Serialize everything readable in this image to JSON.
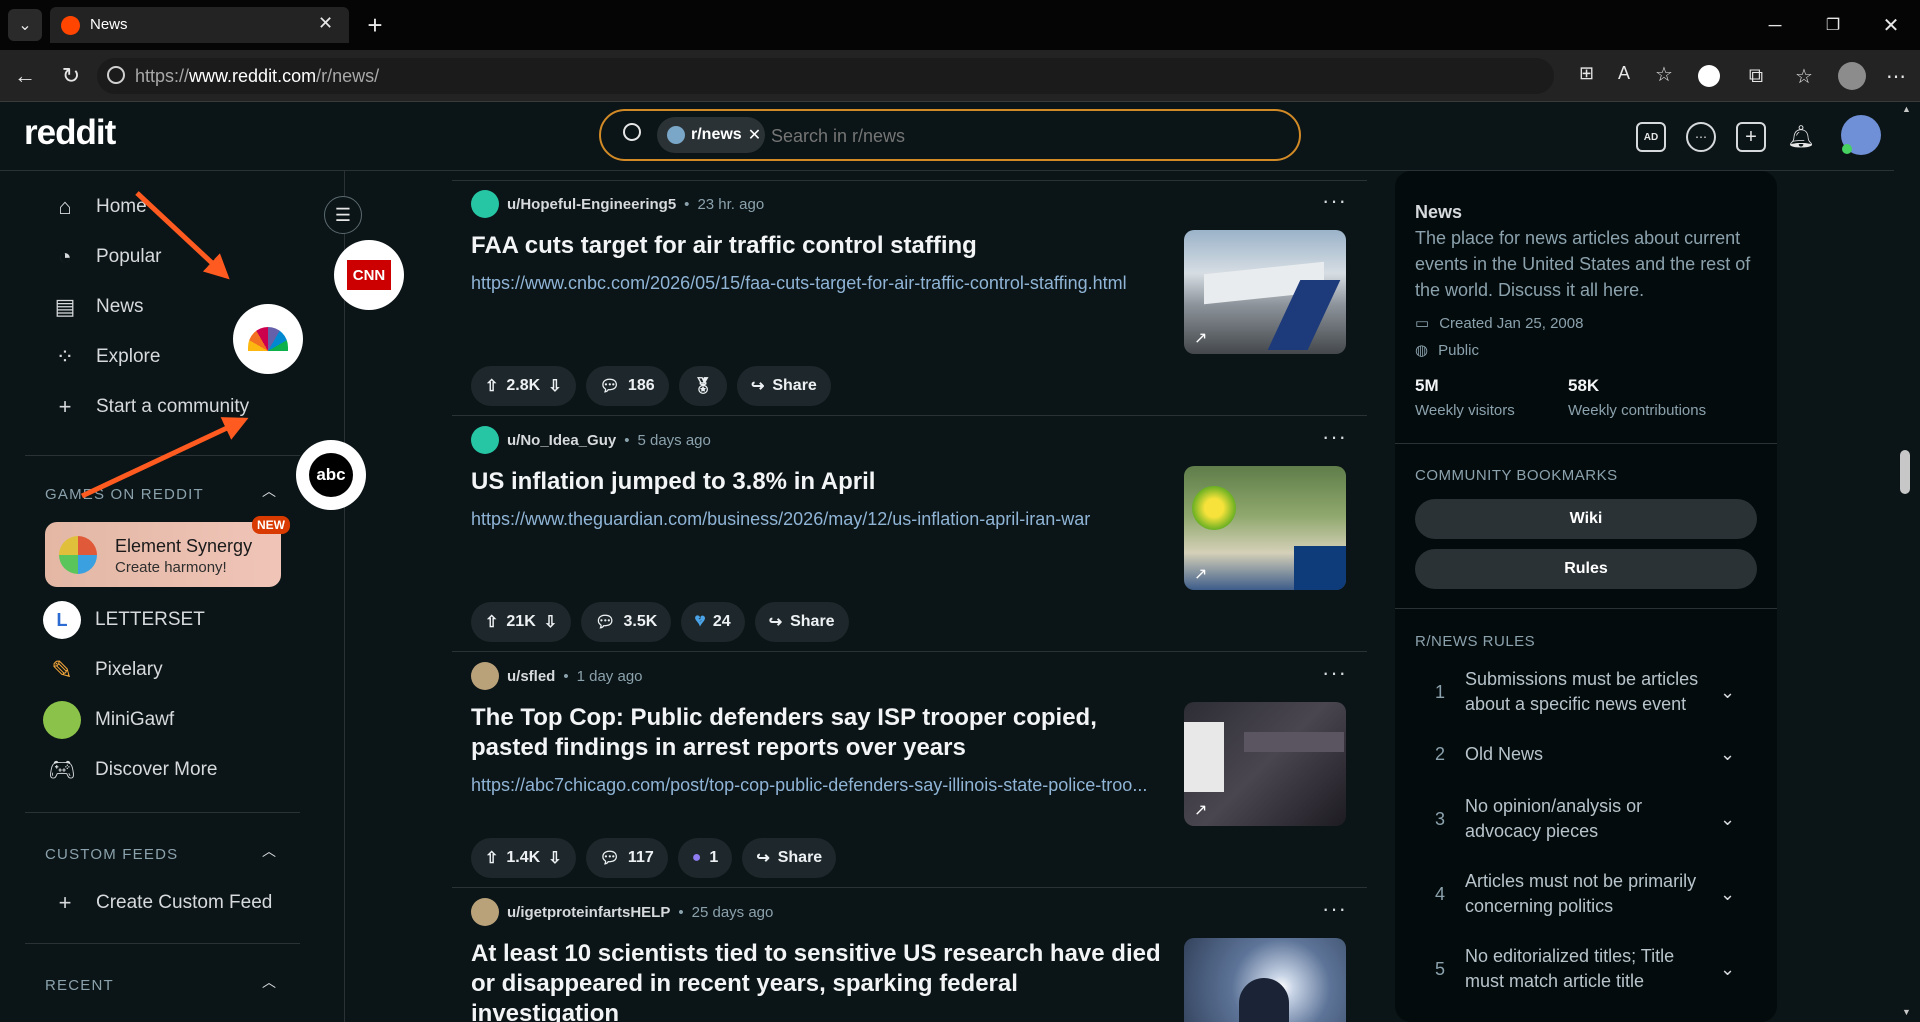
{
  "browser": {
    "tab_title": "News",
    "url_prefix": "https://",
    "url_host": "www.reddit.com",
    "url_path": "/r/news/"
  },
  "header": {
    "logo": "reddit",
    "chip_label": "r/news",
    "search_placeholder": "Search in r/news"
  },
  "sidebar": {
    "nav": [
      {
        "label": "Home",
        "icon": "home-icon"
      },
      {
        "label": "Popular",
        "icon": "popular-icon"
      },
      {
        "label": "News",
        "icon": "news-icon"
      },
      {
        "label": "Explore",
        "icon": "explore-icon"
      },
      {
        "label": "Start a community",
        "icon": "plus-icon"
      }
    ],
    "games_header": "GAMES ON REDDIT",
    "featured_game": {
      "title": "Element Synergy",
      "subtitle": "Create harmony!",
      "badge": "NEW"
    },
    "games": [
      {
        "label": "LETTERSET",
        "icon": "letterset-icon"
      },
      {
        "label": "Pixelary",
        "icon": "pencil-icon"
      },
      {
        "label": "MiniGawf",
        "icon": "minigawf-icon"
      },
      {
        "label": "Discover More",
        "icon": "gamepad-icon"
      }
    ],
    "custom_feeds_header": "CUSTOM FEEDS",
    "create_custom_feed": "Create Custom Feed",
    "recent_header": "RECENT"
  },
  "overlay_logos": {
    "cnn": "CNN",
    "abc": "abc"
  },
  "posts": [
    {
      "author": "u/Hopeful-Engineering5",
      "time": "23 hr. ago",
      "title": "FAA cuts target for air traffic control staffing",
      "link": "https://www.cnbc.com/2026/05/15/faa-cuts-target-for-air-traffic-control-staffing.html",
      "votes": "2.8K",
      "comments": "186",
      "award": ""
    },
    {
      "author": "u/No_Idea_Guy",
      "time": "5 days ago",
      "title": "US inflation jumped to 3.8% in April",
      "link": "https://www.theguardian.com/business/2026/may/12/us-inflation-april-iran-war",
      "votes": "21K",
      "comments": "3.5K",
      "award": "24"
    },
    {
      "author": "u/sfled",
      "time": "1 day ago",
      "title": "The Top Cop: Public defenders say ISP trooper copied, pasted findings in arrest reports over years",
      "link": "https://abc7chicago.com/post/top-cop-public-defenders-say-illinois-state-police-troo...",
      "votes": "1.4K",
      "comments": "117",
      "award": "1"
    },
    {
      "author": "u/igetproteinfartsHELP",
      "time": "25 days ago",
      "title": "At least 10 scientists tied to sensitive US research have died or disappeared in recent years, sparking federal investigation",
      "link": "",
      "votes": "",
      "comments": "",
      "award": ""
    }
  ],
  "share_label": "Share",
  "about": {
    "title": "News",
    "description": "The place for news articles about current events in the United States and the rest of the world. Discuss it all here.",
    "created": "Created Jan 25, 2008",
    "visibility": "Public",
    "visitors_value": "5M",
    "visitors_label": "Weekly visitors",
    "contrib_value": "58K",
    "contrib_label": "Weekly contributions"
  },
  "bookmarks": {
    "header": "COMMUNITY BOOKMARKS",
    "items": [
      "Wiki",
      "Rules"
    ]
  },
  "rules": {
    "header": "R/NEWS RULES",
    "items": [
      {
        "num": "1",
        "text": "Submissions must be articles about a specific news event"
      },
      {
        "num": "2",
        "text": "Old News"
      },
      {
        "num": "3",
        "text": "No opinion/analysis or advocacy pieces"
      },
      {
        "num": "4",
        "text": "Articles must not be primarily concerning politics"
      },
      {
        "num": "5",
        "text": "No editorialized titles; Title must match article title"
      }
    ]
  },
  "colors": {
    "accent_orange": "#ff5a1f",
    "search_border": "#d18a26",
    "background": "#0b1416"
  }
}
